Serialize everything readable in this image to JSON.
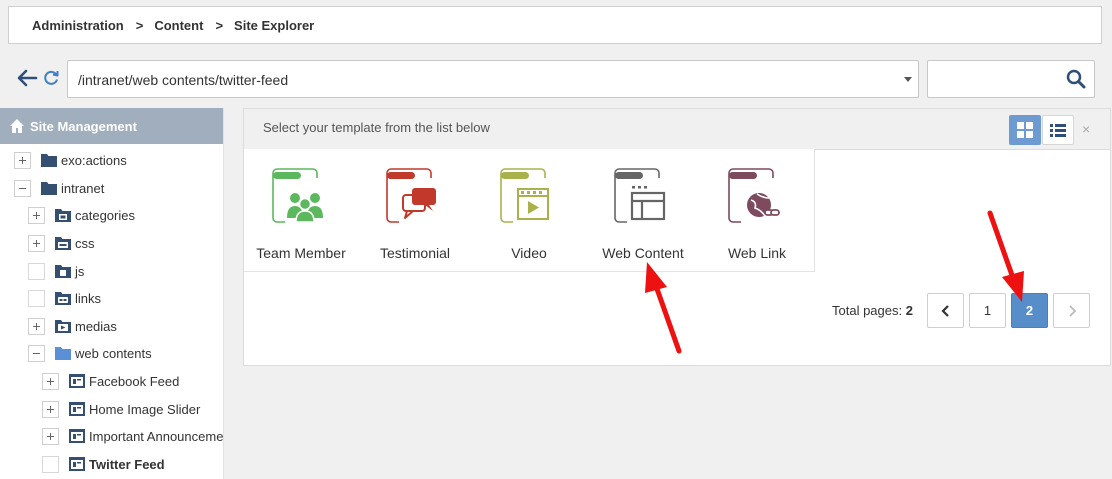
{
  "breadcrumb": {
    "items": [
      "Administration",
      "Content",
      "Site Explorer"
    ],
    "separator": ">"
  },
  "address": {
    "path": "/intranet/web contents/twitter-feed",
    "search_placeholder": ""
  },
  "sidebar": {
    "title": "Site Management",
    "tree": [
      {
        "label": "exo:actions",
        "toggle": "plus"
      },
      {
        "label": "intranet",
        "toggle": "minus"
      },
      {
        "label": "categories",
        "toggle": "plus"
      },
      {
        "label": "css",
        "toggle": "plus"
      },
      {
        "label": "js",
        "toggle": "empty"
      },
      {
        "label": "links",
        "toggle": "empty"
      },
      {
        "label": "medias",
        "toggle": "plus"
      },
      {
        "label": "web contents",
        "toggle": "minus"
      },
      {
        "label": "Facebook Feed",
        "toggle": "plus"
      },
      {
        "label": "Home Image Slider",
        "toggle": "plus"
      },
      {
        "label": "Important Announceme",
        "toggle": "plus"
      },
      {
        "label": "Twitter Feed",
        "toggle": "empty",
        "selected": true
      }
    ]
  },
  "templates": {
    "title": "Select your template from the list below",
    "close_label": "×",
    "items": [
      {
        "label": "Team Member",
        "color": "#5cb85c",
        "icon": "team-member-icon"
      },
      {
        "label": "Testimonial",
        "color": "#c0392b",
        "icon": "testimonial-icon"
      },
      {
        "label": "Video",
        "color": "#a9b24a",
        "icon": "video-icon"
      },
      {
        "label": "Web Content",
        "color": "#666666",
        "icon": "web-content-icon"
      },
      {
        "label": "Web Link",
        "color": "#7d4a5e",
        "icon": "web-link-icon"
      }
    ]
  },
  "pagination": {
    "total_label": "Total pages:",
    "total": "2",
    "pages": [
      "1",
      "2"
    ],
    "current": "2",
    "prev_label": "‹",
    "next_label": "›"
  },
  "colors": {
    "accent": "#578dc9",
    "annotation_arrow": "#ee1111",
    "sidebar_header": "#a0aebe"
  }
}
